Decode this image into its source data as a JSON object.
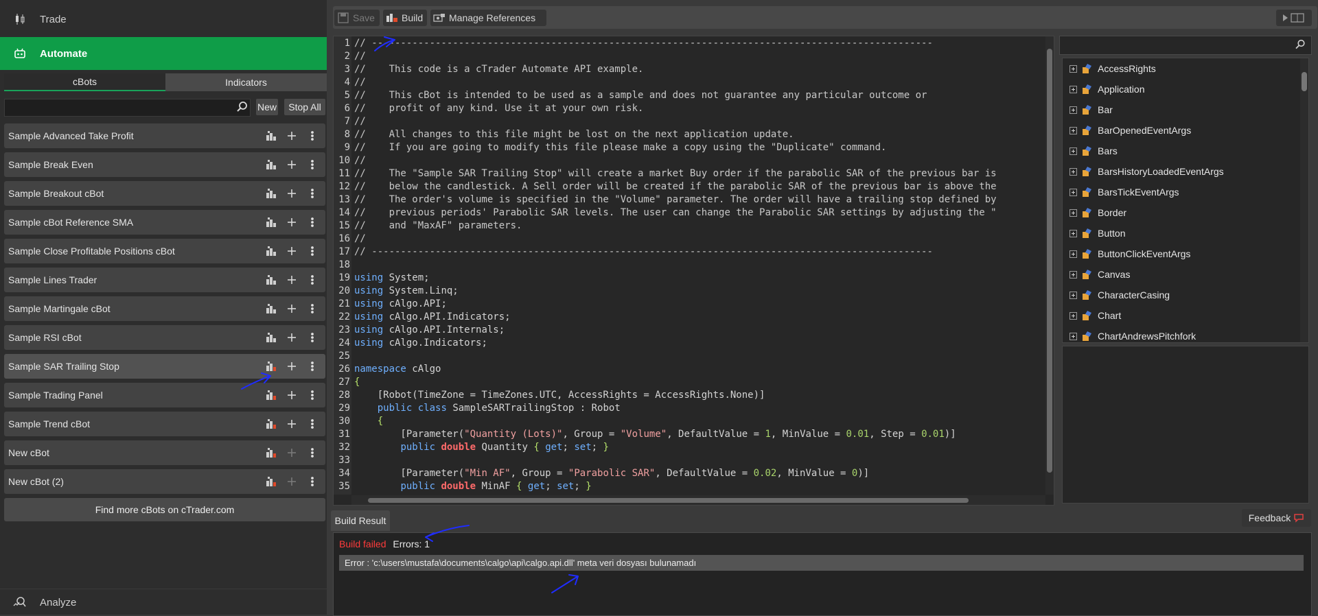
{
  "nav": {
    "trade": "Trade",
    "automate": "Automate",
    "analyze": "Analyze"
  },
  "tabs": {
    "cbots": "cBots",
    "indicators": "Indicators"
  },
  "list_actions": {
    "new": "New",
    "stop_all": "Stop All"
  },
  "bots": [
    {
      "name": "Sample Advanced Take Profit",
      "build_error": false,
      "selected": false,
      "add_enabled": true
    },
    {
      "name": "Sample Break Even",
      "build_error": false,
      "selected": false,
      "add_enabled": true
    },
    {
      "name": "Sample Breakout cBot",
      "build_error": false,
      "selected": false,
      "add_enabled": true
    },
    {
      "name": "Sample cBot Reference SMA",
      "build_error": false,
      "selected": false,
      "add_enabled": true
    },
    {
      "name": "Sample Close Profitable Positions cBot",
      "build_error": false,
      "selected": false,
      "add_enabled": true
    },
    {
      "name": "Sample Lines Trader",
      "build_error": false,
      "selected": false,
      "add_enabled": true
    },
    {
      "name": "Sample Martingale cBot",
      "build_error": false,
      "selected": false,
      "add_enabled": true
    },
    {
      "name": "Sample RSI cBot",
      "build_error": false,
      "selected": false,
      "add_enabled": true
    },
    {
      "name": "Sample SAR Trailing Stop",
      "build_error": true,
      "selected": true,
      "add_enabled": true
    },
    {
      "name": "Sample Trading Panel",
      "build_error": true,
      "selected": false,
      "add_enabled": true
    },
    {
      "name": "Sample Trend cBot",
      "build_error": true,
      "selected": false,
      "add_enabled": true
    },
    {
      "name": "New cBot",
      "build_error": true,
      "selected": false,
      "add_enabled": false
    },
    {
      "name": "New cBot (2)",
      "build_error": true,
      "selected": false,
      "add_enabled": false
    }
  ],
  "find_more": "Find more cBots on cTrader.com",
  "toolbar": {
    "save": "Save",
    "build": "Build",
    "manage": "Manage References"
  },
  "code_lines": [
    "// -------------------------------------------------------------------------------------------------",
    "//",
    "//    This code is a cTrader Automate API example.",
    "//",
    "//    This cBot is intended to be used as a sample and does not guarantee any particular outcome or",
    "//    profit of any kind. Use it at your own risk.",
    "//",
    "//    All changes to this file might be lost on the next application update.",
    "//    If you are going to modify this file please make a copy using the \"Duplicate\" command.",
    "//",
    "//    The \"Sample SAR Trailing Stop\" will create a market Buy order if the parabolic SAR of the previous bar is",
    "//    below the candlestick. A Sell order will be created if the parabolic SAR of the previous bar is above the",
    "//    The order's volume is specified in the \"Volume\" parameter. The order will have a trailing stop defined by",
    "//    previous periods' Parabolic SAR levels. The user can change the Parabolic SAR settings by adjusting the \"",
    "//    and \"MaxAF\" parameters.",
    "//",
    "// -------------------------------------------------------------------------------------------------",
    "",
    "using System;",
    "using System.Linq;",
    "using cAlgo.API;",
    "using cAlgo.API.Indicators;",
    "using cAlgo.API.Internals;",
    "using cAlgo.Indicators;",
    "",
    "namespace cAlgo",
    "{",
    "    [Robot(TimeZone = TimeZones.UTC, AccessRights = AccessRights.None)]",
    "    public class SampleSARTrailingStop : Robot",
    "    {",
    "        [Parameter(\"Quantity (Lots)\", Group = \"Volume\", DefaultValue = 1, MinValue = 0.01, Step = 0.01)]",
    "        public double Quantity { get; set; }",
    "",
    "        [Parameter(\"Min AF\", Group = \"Parabolic SAR\", DefaultValue = 0.02, MinValue = 0)]",
    "        public double MinAF { get; set; }"
  ],
  "api_tree": [
    "AccessRights",
    "Application",
    "Bar",
    "BarOpenedEventArgs",
    "Bars",
    "BarsHistoryLoadedEventArgs",
    "BarsTickEventArgs",
    "Border",
    "Button",
    "ButtonClickEventArgs",
    "Canvas",
    "CharacterCasing",
    "Chart",
    "ChartAndrewsPitchfork"
  ],
  "build_result": {
    "tab": "Build Result",
    "feedback": "Feedback",
    "status": "Build failed",
    "errors_label": "Errors:",
    "errors_count": "1",
    "error_message": "Error : 'c:\\users\\mustafa\\documents\\calgo\\api\\calgo.api.dll' meta veri dosyası bulunamadı"
  },
  "colors": {
    "accent": "#0f9d48",
    "error": "#ff3b3b",
    "annotation": "#1f2cff"
  }
}
